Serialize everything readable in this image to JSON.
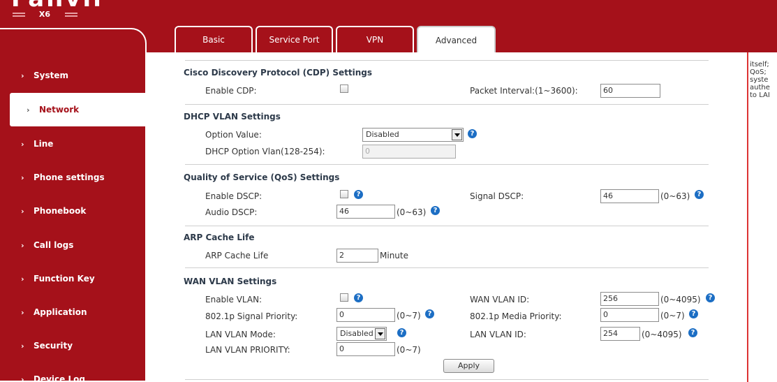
{
  "brand": {
    "logo": "Fanvil",
    "model": "X6"
  },
  "tabs": [
    {
      "label": "Basic"
    },
    {
      "label": "Service Port"
    },
    {
      "label": "VPN"
    },
    {
      "label": "Advanced"
    }
  ],
  "sidebar": {
    "items": [
      {
        "label": "System"
      },
      {
        "label": "Network"
      },
      {
        "label": "Line"
      },
      {
        "label": "Phone settings"
      },
      {
        "label": "Phonebook"
      },
      {
        "label": "Call logs"
      },
      {
        "label": "Function Key"
      },
      {
        "label": "Application"
      },
      {
        "label": "Security"
      },
      {
        "label": "Device Log"
      }
    ]
  },
  "cdp": {
    "title": "Cisco Discovery Protocol (CDP) Settings",
    "enable_label": "Enable CDP:",
    "interval_label": "Packet Interval:(1~3600):",
    "interval_value": "60"
  },
  "dhcp_vlan": {
    "title": "DHCP VLAN Settings",
    "option_label": "Option Value:",
    "option_value": "Disabled",
    "vlan_label": "DHCP Option Vlan(128-254):",
    "vlan_value": "0"
  },
  "qos": {
    "title": "Quality of Service (QoS) Settings",
    "enable_label": "Enable DSCP:",
    "signal_label": "Signal DSCP:",
    "signal_value": "46",
    "signal_range": "(0~63)",
    "audio_label": "Audio DSCP:",
    "audio_value": "46",
    "audio_range": "(0~63)"
  },
  "arp": {
    "title": "ARP Cache Life",
    "label": "ARP Cache Life",
    "value": "2",
    "unit": "Minute"
  },
  "wan_vlan": {
    "title": "WAN VLAN Settings",
    "enable_label": "Enable VLAN:",
    "wan_id_label": "WAN VLAN ID:",
    "wan_id_value": "256",
    "wan_id_range": "(0~4095)",
    "signal_prio_label": "802.1p Signal Priority:",
    "signal_prio_value": "0",
    "signal_prio_range": "(0~7)",
    "media_prio_label": "802.1p Media Priority:",
    "media_prio_value": "0",
    "media_prio_range": "(0~7)",
    "lan_mode_label": "LAN VLAN Mode:",
    "lan_mode_value": "Disabled",
    "lan_id_label": "LAN VLAN ID:",
    "lan_id_value": "254",
    "lan_id_range": "(0~4095)",
    "lan_prio_label": "LAN VLAN PRIORITY:",
    "lan_prio_value": "0",
    "lan_prio_range": "(0~7)"
  },
  "apply_label": "Apply",
  "help_panel": {
    "text": "itself;\nQoS;\nsyste\nauthe\nto LAI"
  },
  "colors": {
    "brand_red": "#a5111a",
    "help_blue": "#1c6ec4",
    "help_border": "#d33"
  }
}
